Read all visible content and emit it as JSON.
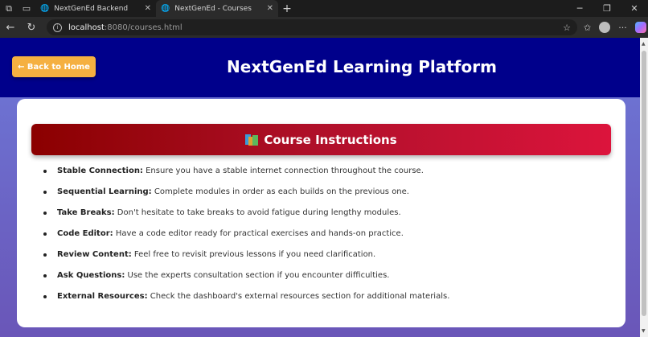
{
  "browser": {
    "tabs": [
      {
        "title": "NextGenEd Backend",
        "active": false
      },
      {
        "title": "NextGenEd - Courses",
        "active": true
      }
    ],
    "url_host": "localhost",
    "url_path": ":8080/courses.html"
  },
  "header": {
    "back_button": "← Back to Home",
    "site_title": "NextGenEd Learning Platform"
  },
  "instructions": {
    "title": "Course Instructions",
    "icon": "books-icon",
    "items": [
      {
        "term": "Stable Connection:",
        "text": " Ensure you have a stable internet connection throughout the course."
      },
      {
        "term": "Sequential Learning:",
        "text": " Complete modules in order as each builds on the previous one."
      },
      {
        "term": "Take Breaks:",
        "text": " Don't hesitate to take breaks to avoid fatigue during lengthy modules."
      },
      {
        "term": "Code Editor:",
        "text": " Have a code editor ready for practical exercises and hands-on practice."
      },
      {
        "term": "Review Content:",
        "text": " Feel free to revisit previous lessons if you need clarification."
      },
      {
        "term": "Ask Questions:",
        "text": " Use the experts consultation section if you encounter difficulties."
      },
      {
        "term": "External Resources:",
        "text": " Check the dashboard's external resources section for additional materials."
      }
    ]
  },
  "colors": {
    "header_bg": "#00008b",
    "back_button_bg": "#f5b041",
    "banner_start": "#8b0000",
    "banner_end": "#dc143c",
    "page_bg": "#6e79d8"
  }
}
